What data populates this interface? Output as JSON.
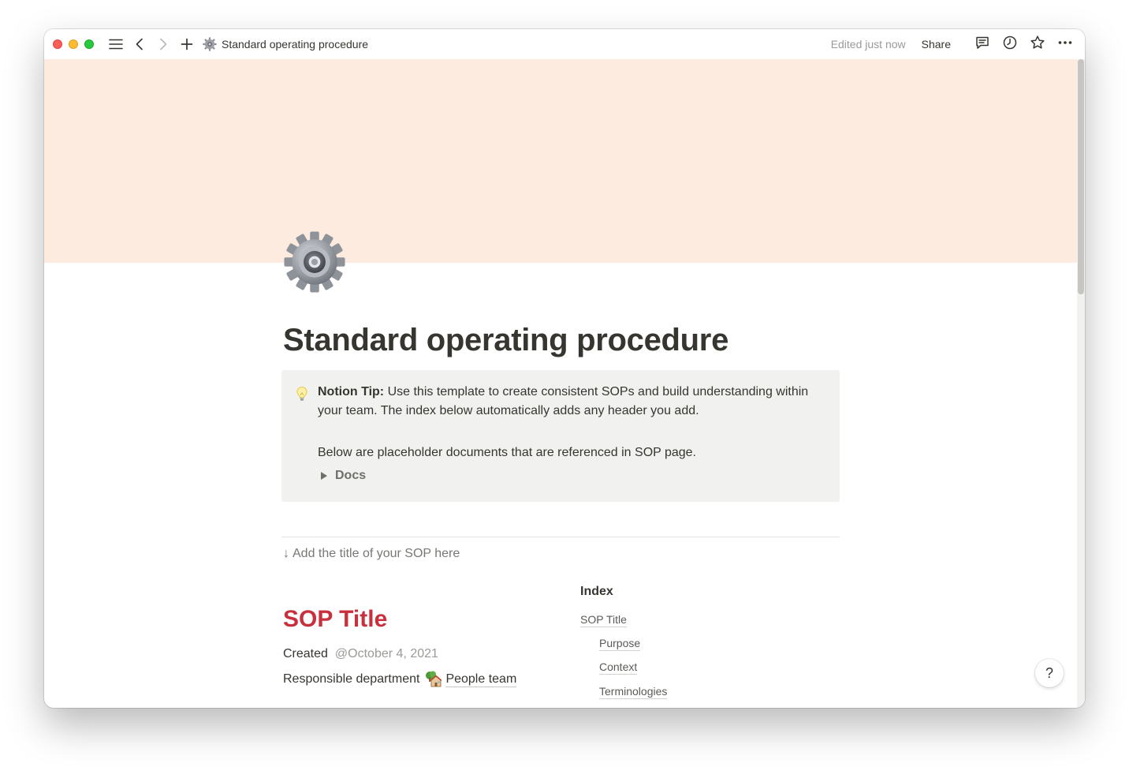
{
  "window": {
    "tab_title": "Standard operating procedure",
    "edited_status": "Edited just now",
    "share_label": "Share"
  },
  "page": {
    "title": "Standard operating procedure",
    "cover_color": "#fdebe0",
    "icon": "gear-icon"
  },
  "callout": {
    "icon": "lightbulb-icon",
    "tip_label": "Notion Tip:",
    "tip_text": " Use this template to create consistent SOPs and build understanding within your team. The index below automatically adds any header you add.",
    "paragraph2": "Below are placeholder documents that are referenced in SOP page.",
    "toggle_label": "Docs"
  },
  "hint": {
    "arrow": "↓",
    "text": "Add the title of your SOP here"
  },
  "sop": {
    "title": "SOP Title",
    "title_color": "#c9303e",
    "created_label": "Created",
    "created_value": "@October 4, 2021",
    "department_label": "Responsible department",
    "department_value": "People team"
  },
  "index": {
    "title": "Index",
    "items": [
      {
        "label": "SOP Title",
        "level": 0
      },
      {
        "label": "Purpose",
        "level": 1
      },
      {
        "label": "Context",
        "level": 1
      },
      {
        "label": "Terminologies",
        "level": 1
      }
    ]
  },
  "help": {
    "label": "?"
  }
}
